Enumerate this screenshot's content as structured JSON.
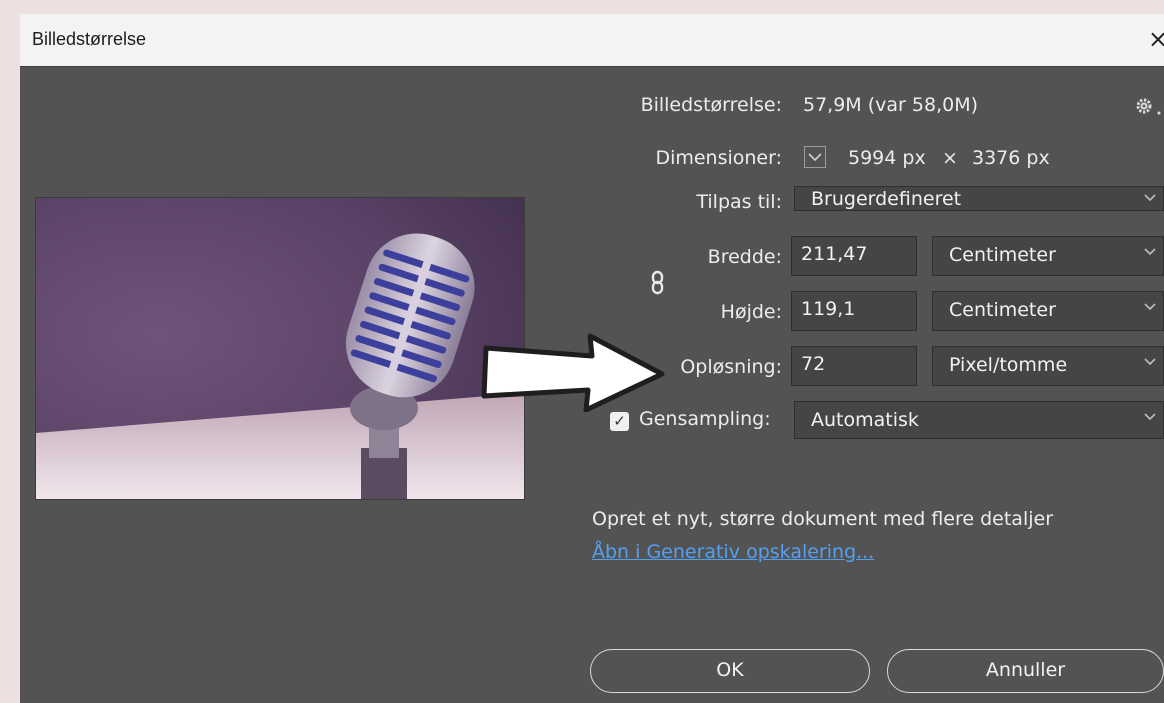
{
  "dialog": {
    "title": "Billedstørrelse",
    "close_glyph": "×"
  },
  "info": {
    "size_label": "Billedstørrelse:",
    "size_value": "57,9M (var 58,0M)",
    "dimensions_label": "Dimensioner:",
    "dim_width": "5994 px",
    "dim_times": "×",
    "dim_height": "3376 px"
  },
  "fit": {
    "label": "Tilpas til:",
    "value": "Brugerdefineret"
  },
  "width": {
    "label": "Bredde:",
    "value": "211,47",
    "unit": "Centimeter"
  },
  "height": {
    "label": "Højde:",
    "value": "119,1",
    "unit": "Centimeter"
  },
  "resolution": {
    "label": "Opløsning:",
    "value": "72",
    "unit": "Pixel/tomme"
  },
  "resample": {
    "label": "Gensampling:",
    "checked": true,
    "value": "Automatisk"
  },
  "upscale": {
    "description": "Opret et nyt, større dokument med flere detaljer",
    "link": "Åbn i Generativ opskalering..."
  },
  "buttons": {
    "ok": "OK",
    "cancel": "Annuller"
  },
  "icons": {
    "settings": "gear-icon",
    "link_chain": "chain-link-icon",
    "dropdown": "chevron-down-icon",
    "annotation": "arrow-icon"
  },
  "colors": {
    "dialog_bg": "#535353",
    "field_bg": "#454545",
    "link": "#54a0f0",
    "page_bg": "#ede1df"
  }
}
